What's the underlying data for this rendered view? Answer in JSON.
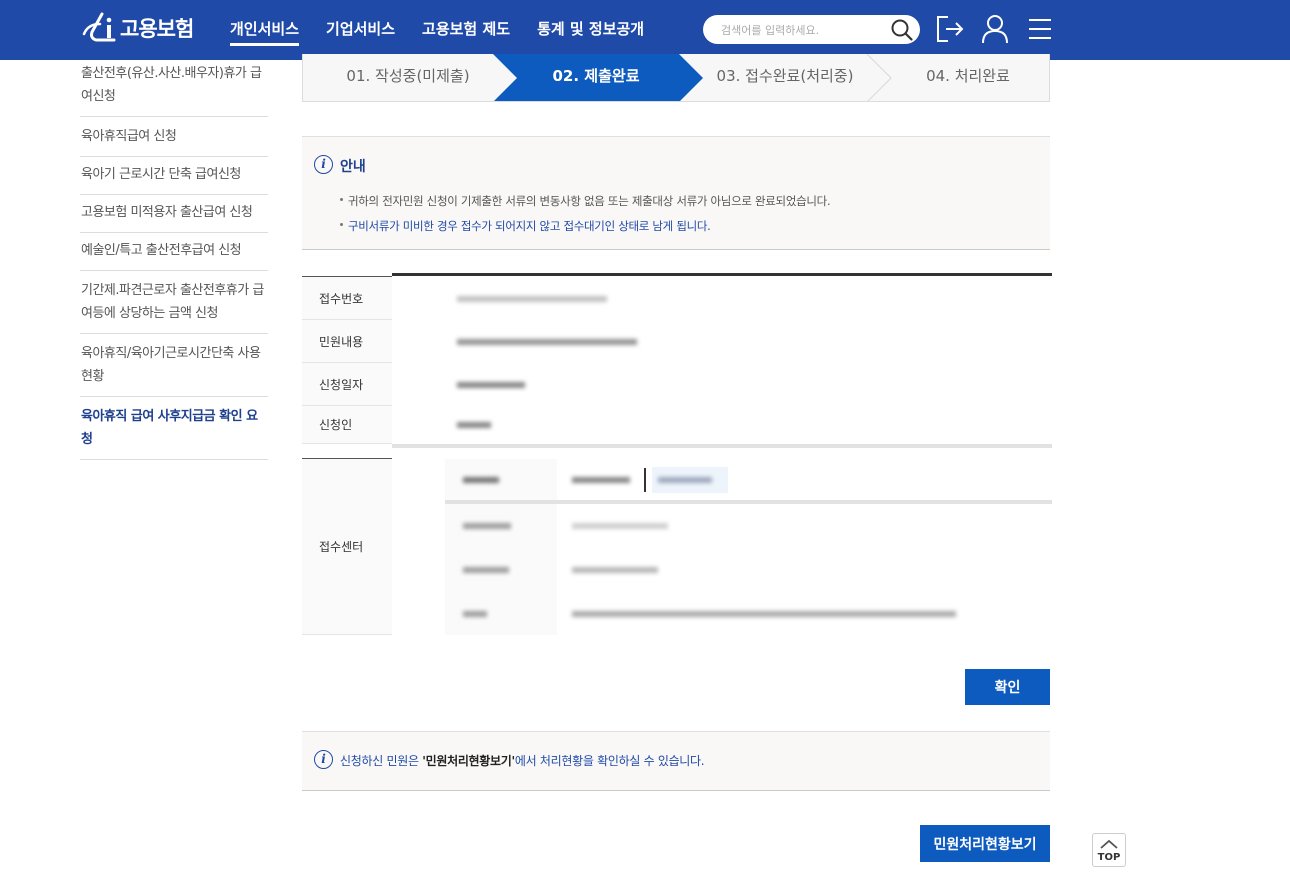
{
  "header": {
    "logo_text": "고용보험",
    "nav": [
      "개인서비스",
      "기업서비스",
      "고용보험 제도",
      "통계 및 정보공개"
    ],
    "active_nav": 0,
    "search_placeholder": "검색어를 입력하세요.",
    "colors": {
      "bar": "#1f4aa8",
      "accent": "#0e5bbf"
    }
  },
  "sidebar": {
    "items": [
      "출산전후(유산.사산.배우자)휴가 급여신청",
      "육아휴직급여 신청",
      "육아기 근로시간 단축 급여신청",
      "고용보험 미적용자 출산급여 신청",
      "예술인/특고 출산전후급여 신청",
      "기간제.파견근로자 출산전후휴가 급여등에 상당하는 금액 신청",
      "육아휴직/육아기근로시간단축 사용현황",
      "육아휴직 급여 사후지급금 확인 요청"
    ],
    "active_index": 7
  },
  "steps": [
    "01. 작성중(미제출)",
    "02. 제출완료",
    "03. 접수완료(처리중)",
    "04. 처리완료"
  ],
  "notice": {
    "title": "안내",
    "line1": "귀하의 전자민원 신청이 기제출한 서류의 변동사항 없음 또는 제출대상 서류가 아님으로 완료되었습니다.",
    "line2": "구비서류가 미비한 경우 접수가 되어지지 않고 접수대기인 상태로 남게 됩니다."
  },
  "table": {
    "labels": [
      "접수번호",
      "민원내용",
      "신청일자",
      "신청인",
      "접수센터"
    ]
  },
  "buttons": {
    "confirm": "확인",
    "status": "민원처리현황보기",
    "top": "TOP"
  },
  "bottom_notice": {
    "prefix": "신청하신 민원은 ",
    "bold": "'민원처리현황보기'",
    "suffix": "에서 처리현황을 확인하실 수 있습니다."
  }
}
